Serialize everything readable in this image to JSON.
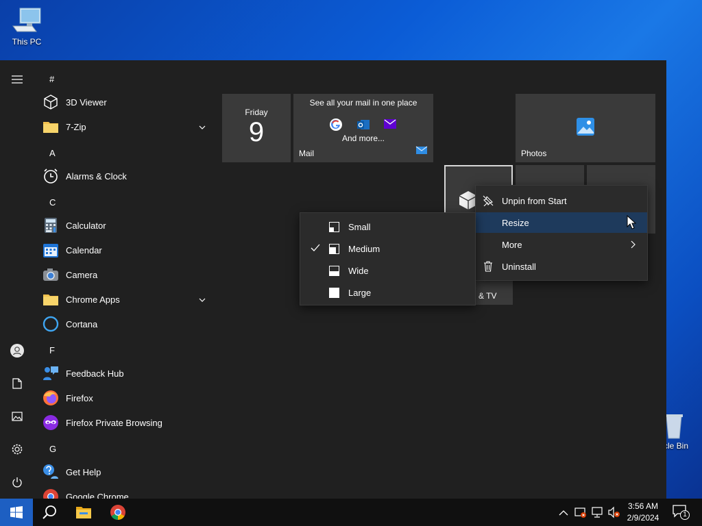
{
  "desktop": {
    "this_pc_label": "This PC",
    "recycle_bin_label": "cle Bin"
  },
  "rail": {
    "icons": [
      "hamburger-menu-icon",
      "user-icon",
      "document-icon",
      "pictures-icon",
      "settings-icon",
      "power-icon"
    ]
  },
  "applist": {
    "groups": {
      "hash": "#",
      "a": "A",
      "c": "C",
      "f": "F",
      "g": "G"
    },
    "apps": {
      "viewer3d": "3D Viewer",
      "zip": "7-Zip",
      "alarms": "Alarms & Clock",
      "calculator": "Calculator",
      "calendar": "Calendar",
      "camera": "Camera",
      "chrome_apps": "Chrome Apps",
      "cortana": "Cortana",
      "feedback": "Feedback Hub",
      "firefox": "Firefox",
      "firefox_private": "Firefox Private Browsing",
      "get_help": "Get Help",
      "google_chrome": "Google Chrome"
    }
  },
  "tiles": {
    "calendar_day": "Friday",
    "calendar_date": "9",
    "mail_headline": "See all your mail in one place",
    "mail_more": "And more...",
    "mail_label": "Mail",
    "photos_label": "Photos",
    "movies_label_partial": "& TV"
  },
  "context_menu": {
    "unpin": "Unpin from Start",
    "resize": "Resize",
    "more": "More",
    "uninstall": "Uninstall"
  },
  "resize_submenu": {
    "small": "Small",
    "medium": "Medium",
    "wide": "Wide",
    "large": "Large",
    "selected": "Medium"
  },
  "taskbar": {
    "time": "3:56 AM",
    "date": "2/9/2024",
    "notification_count": "1"
  },
  "colors": {
    "start_bg": "#202020",
    "tile_bg": "#3a3a3a",
    "menu_bg": "#2b2b2b",
    "menu_highlight": "#1e3a5c",
    "taskbar_bg": "#101010"
  }
}
